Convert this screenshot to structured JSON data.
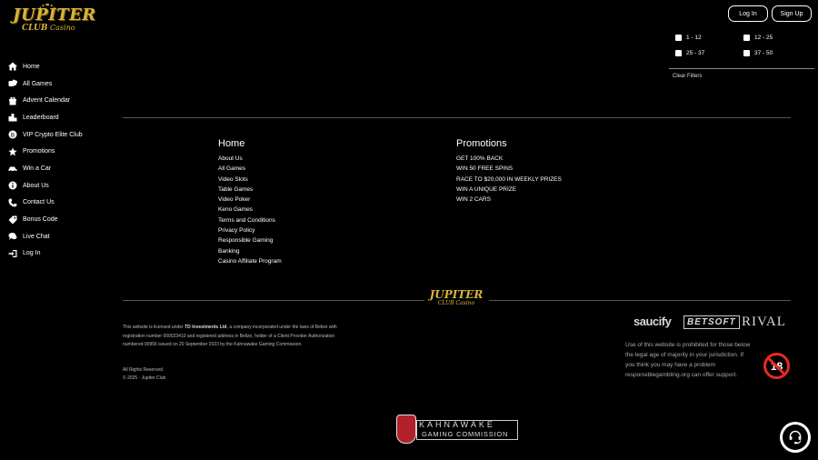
{
  "logo": {
    "line1": "JUPITER",
    "line2a": "CLUB",
    "line2b": "Casino"
  },
  "header": {
    "login_label": "Log In",
    "signup_label": "Sign Up"
  },
  "sidebar": {
    "items": [
      {
        "label": "Home",
        "icon": "home-icon"
      },
      {
        "label": "All Games",
        "icon": "dice-icon"
      },
      {
        "label": "Advent Calendar",
        "icon": "gift-icon"
      },
      {
        "label": "Leaderboard",
        "icon": "leaderboard-icon"
      },
      {
        "label": "VIP Crypto Elite Club",
        "icon": "bitcoin-icon"
      },
      {
        "label": "Promotions",
        "icon": "star-icon"
      },
      {
        "label": "Win a Car",
        "icon": "car-icon"
      },
      {
        "label": "About Us",
        "icon": "info-icon"
      },
      {
        "label": "Contact Us",
        "icon": "phone-icon"
      },
      {
        "label": "Bonus Code",
        "icon": "tag-icon"
      },
      {
        "label": "Live Chat",
        "icon": "chat-icon"
      },
      {
        "label": "Log In",
        "icon": "login-icon"
      }
    ]
  },
  "filters": {
    "options": [
      "1 - 12",
      "12 - 25",
      "25 - 37",
      "37 - 50"
    ],
    "clear_label": "Clear Filters"
  },
  "footer": {
    "col1": {
      "heading": "Home",
      "links": [
        "About Us",
        "All Games",
        "Video Slots",
        "Table Games",
        "Video Poker",
        "Keno Games",
        "Terms and Conditions",
        "Privacy Policy",
        "Responsible Gaming",
        "Banking",
        "Casino Affiliate Program"
      ]
    },
    "col2": {
      "heading": "Promotions",
      "links": [
        "GET 100% BACK",
        "WIN 50 FREE SPINS",
        "RACE TO $20,000 IN WEEKLY PRIZES",
        "WIN A UNIQUE PRIZE",
        "WIN 2 CARS"
      ]
    },
    "legal_pre": "This website is licensed under ",
    "legal_company": "TD Investments Ltd",
    "legal_post": ", a company incorporated under the laws of Belize with registration number 000023410 and registered address in Belize, holder of a Client Provider Authorization numbered 00956 issued on 20 September 2023 by the Kahnawake Gaming Commission.",
    "rights": "All Rights Reserved.",
    "copyright": "© 2025 - Jupiter Club",
    "providers": [
      "saucify",
      "BETSOFT",
      "RIVAL"
    ],
    "age_notice": "Use of this website is prohibited for those below the legal age of majority in your jurisdiction. If you think you may have a problem responsiblegambling.org can offer support.",
    "age_badge": "18",
    "kgc_line1": "KAHNAWAKE",
    "kgc_line2": "GAMING COMMISSION"
  }
}
